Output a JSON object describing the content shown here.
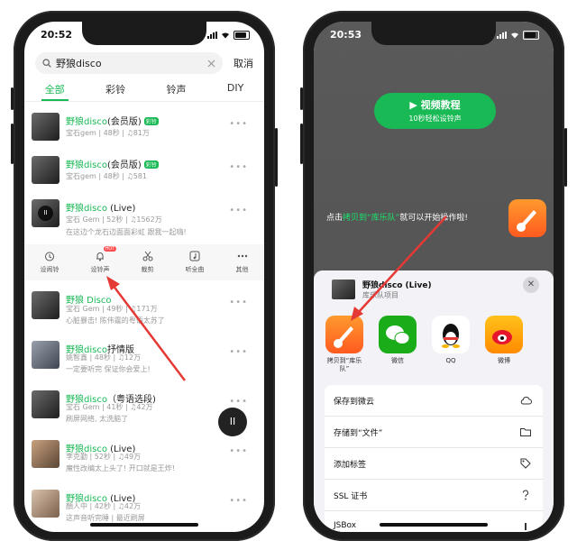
{
  "left": {
    "status_time": "20:52",
    "search": {
      "query": "野狼disco",
      "cancel_label": "取消"
    },
    "tabs": [
      {
        "label": "全部",
        "active": true
      },
      {
        "label": "彩铃",
        "active": false
      },
      {
        "label": "铃声",
        "active": false
      },
      {
        "label": "DIY",
        "active": false
      }
    ],
    "songs": [
      {
        "title_green": "野狼disco",
        "title_rest": "(会员版)",
        "badge": "彩铃",
        "meta": "宝石gem | 48秒 | ♫81万"
      },
      {
        "title_green": "野狼disco",
        "title_rest": "(会员版)",
        "badge": "彩铃",
        "meta": "宝石gem | 48秒 | ♫581"
      },
      {
        "title_green": "野狼disco",
        "title_rest": " (Live)",
        "badge": "",
        "meta": "宝石 Gem | 52秒 | ♫1562万",
        "desc": "在这边个龙石边面面彩虹 跟我一起嗨!"
      },
      {
        "title_green": "野狼 Disco",
        "title_rest": "",
        "badge": "",
        "meta": "宝石 Gem | 49秒 | ♫171万",
        "desc": "心脏暴击! 陈伟霆的粤语太苏了"
      },
      {
        "title_green": "野狼disco",
        "title_rest": "抒情版",
        "badge": "",
        "meta": "姚智鑫 | 48秒 | ♫12万",
        "desc": "一定要听完 保证你会爱上!"
      },
      {
        "title_green": "野狼disco",
        "title_rest": "（粤语选段)",
        "badge": "",
        "meta": "宝石 Gem | 41秒 | ♫42万",
        "desc": "刷屏网络, 太洗脑了"
      },
      {
        "title_green": "野狼disco",
        "title_rest": " (Live)",
        "badge": "",
        "meta": "李克勤 | 52秒 | ♫49万",
        "desc": "魔性改编太上头了! 开口就是王炸!"
      },
      {
        "title_green": "野狼disco",
        "title_rest": " (Live)",
        "badge": "",
        "meta": "顏人中 | 42秒 | ♫42万",
        "desc": "这声音听完睡 | 最近刷屏"
      }
    ],
    "actions": [
      {
        "label": "设闹铃",
        "icon": "alarm-icon"
      },
      {
        "label": "设铃声",
        "icon": "bell-icon",
        "hot": "HOT"
      },
      {
        "label": "裁剪",
        "icon": "scissors-icon"
      },
      {
        "label": "听全曲",
        "icon": "music-note-icon"
      },
      {
        "label": "其他",
        "icon": "more-icon"
      }
    ],
    "more_dots": "•••",
    "float_play": "II"
  },
  "right": {
    "status_time": "20:53",
    "video_button": {
      "line1": "视频教程",
      "line2": "10秒轻松设铃声"
    },
    "hint": {
      "before": "点击",
      "highlight": "拷贝到“库乐队”",
      "after": "就可以开始操作啦!"
    },
    "sheet": {
      "title": "野狼disco (Live)",
      "subtitle": "库乐队项目",
      "close": "✕"
    },
    "apps": [
      {
        "label": "拷贝到“库乐队”",
        "icon": "garageband-icon",
        "color": "#ff6a1f"
      },
      {
        "label": "微信",
        "icon": "wechat-icon",
        "color": "#1aad19"
      },
      {
        "label": "QQ",
        "icon": "qq-icon",
        "color": "#ffffff"
      },
      {
        "label": "微博",
        "icon": "weibo-icon",
        "color": "#ff9b00"
      }
    ],
    "menu": [
      {
        "label": "保存到微云",
        "icon": "cloud-icon"
      },
      {
        "label": "存储到“文件”",
        "icon": "folder-icon"
      },
      {
        "label": "添加标签",
        "icon": "tag-icon"
      },
      {
        "label": "SSL 证书",
        "icon": "certificate-icon"
      },
      {
        "label": "JSBox",
        "icon": "jsbox-icon"
      }
    ]
  },
  "colors": {
    "accent": "#19b955",
    "arrow": "#e53935"
  }
}
